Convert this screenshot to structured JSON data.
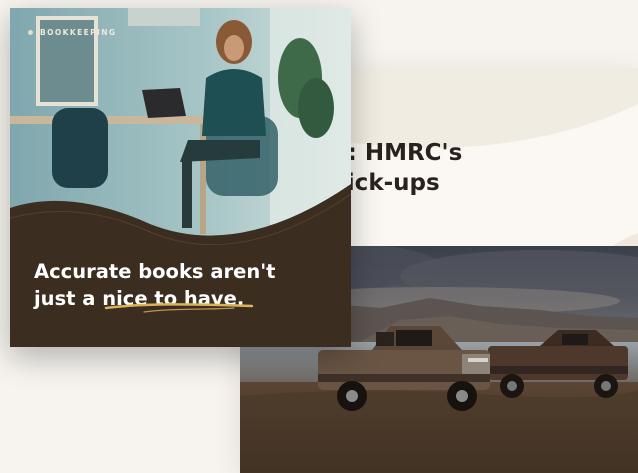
{
  "back_card": {
    "title_line1": "he truck: HMRC's",
    "title_line2": "les for pick-ups",
    "photo_subject": "two pickup trucks parked on a lakeshore under a cloudy sky"
  },
  "front_card": {
    "eyebrow": "BOOKKEEPING",
    "headline_line1": "Accurate books aren't",
    "headline_line2": "just a nice to have.",
    "photo_subject": "woman at a laptop in a bright office",
    "colors": {
      "background": "#3b2d1f",
      "underline": "#d9b25a",
      "text": "#ffffff"
    }
  }
}
